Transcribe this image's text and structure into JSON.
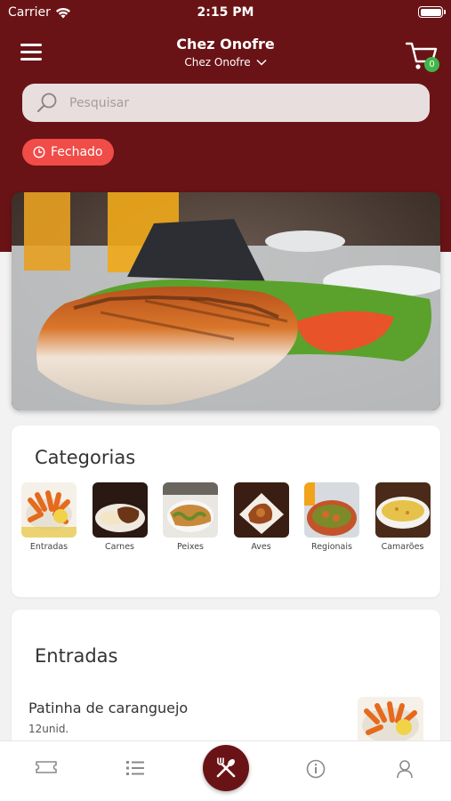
{
  "status_bar": {
    "carrier": "Carrier",
    "time": "2:15 PM"
  },
  "header": {
    "title": "Chez Onofre",
    "restaurant_selector": "Chez Onofre",
    "cart_count": "0"
  },
  "search": {
    "placeholder": "Pesquisar"
  },
  "store_status": {
    "label": "Fechado",
    "color": "#f04c48"
  },
  "categories_section": {
    "title": "Categorias",
    "items": [
      {
        "label": "Entradas"
      },
      {
        "label": "Carnes"
      },
      {
        "label": "Peixes"
      },
      {
        "label": "Aves"
      },
      {
        "label": "Regionais"
      },
      {
        "label": "Camarões"
      }
    ]
  },
  "entradas_section": {
    "title": "Entradas",
    "products": [
      {
        "name": "Patinha de caranguejo",
        "description": "12unid."
      }
    ]
  },
  "tab_bar": {
    "items": [
      {
        "icon": "ticket-icon"
      },
      {
        "icon": "list-icon"
      },
      {
        "icon": "cutlery-icon"
      },
      {
        "icon": "info-icon"
      },
      {
        "icon": "user-icon"
      }
    ]
  },
  "colors": {
    "brand": "#6a1316",
    "badge": "#41b549",
    "closed": "#f04c48"
  }
}
